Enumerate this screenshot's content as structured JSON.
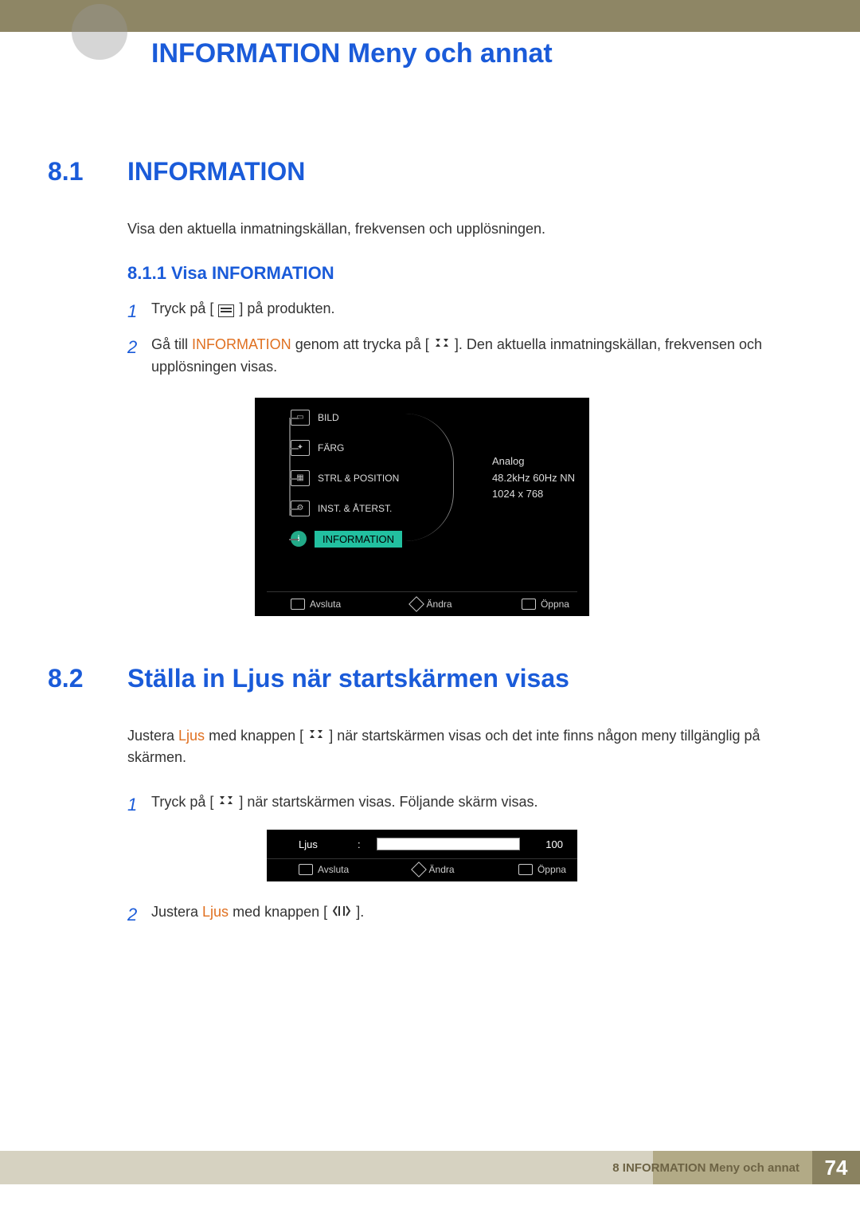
{
  "header": {
    "chapter_title": "INFORMATION Meny och annat"
  },
  "section1": {
    "num": "8.1",
    "title": "INFORMATION",
    "intro": "Visa den aktuella inmatningskällan, frekvensen och upplösningen.",
    "sub": {
      "num_title": "8.1.1  Visa INFORMATION"
    },
    "steps": {
      "s1_a": "Tryck på [",
      "s1_b": "] på produkten.",
      "s2_a": "Gå till ",
      "s2_kw": "INFORMATION",
      "s2_b": " genom att trycka på [",
      "s2_c": "]. Den aktuella inmatningskällan, frekvensen och upplösningen visas."
    }
  },
  "osd_menu": {
    "items": [
      "BILD",
      "FÄRG",
      "STRL & POSITION",
      "INST. & ÅTERST.",
      "INFORMATION"
    ],
    "info": {
      "source": "Analog",
      "freq": "48.2kHz 60Hz NN",
      "res": "1024 x 768"
    },
    "footer": {
      "exit": "Avsluta",
      "change": "Ändra",
      "open": "Öppna"
    }
  },
  "section2": {
    "num": "8.2",
    "title": "Ställa in Ljus när startskärmen visas",
    "intro_a": "Justera ",
    "intro_kw": "Ljus",
    "intro_b": " med knappen [",
    "intro_c": "] när startskärmen visas och det inte finns någon meny tillgänglig på skärmen.",
    "steps": {
      "s1_a": "Tryck på [",
      "s1_b": "] när startskärmen visas. Följande skärm visas.",
      "s2_a": "Justera ",
      "s2_kw": "Ljus",
      "s2_b": " med knappen [",
      "s2_c": "]."
    }
  },
  "osd_bright": {
    "label": "Ljus",
    "value": "100",
    "footer": {
      "exit": "Avsluta",
      "change": "Ändra",
      "open": "Öppna"
    }
  },
  "chart_data": {
    "type": "bar",
    "title": "Ljus",
    "categories": [
      "Ljus"
    ],
    "values": [
      100
    ],
    "ylim": [
      0,
      100
    ]
  },
  "footer": {
    "label": "8 INFORMATION Meny och annat",
    "page": "74"
  }
}
